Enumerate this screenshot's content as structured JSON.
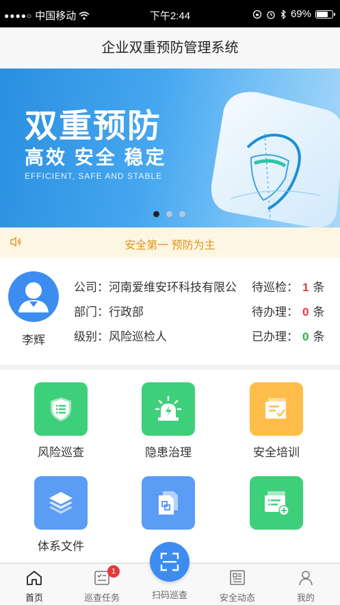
{
  "status_bar": {
    "carrier": "中国移动",
    "time": "下午2:44",
    "battery": "69%"
  },
  "nav": {
    "title": "企业双重预防管理系统"
  },
  "banner": {
    "title": "双重预防",
    "subtitle": "高效 安全 稳定",
    "english": "EFFICIENT, SAFE AND STABLE",
    "page_count": 3,
    "active_page": 1
  },
  "notice": {
    "text": "安全第一 预防为主"
  },
  "profile": {
    "name": "李辉",
    "company_label": "公司：",
    "company": "河南爱维安环科技有限公",
    "department_label": "部门：",
    "department": "行政部",
    "level_label": "级别：",
    "level": "风险巡检人",
    "pending_inspection_label": "待巡检：",
    "pending_inspection": "1",
    "pending_handle_label": "待办理：",
    "pending_handle": "0",
    "done_label": "已办理：",
    "done": "0",
    "unit": "条"
  },
  "menu": {
    "items": [
      {
        "label": "风险巡查",
        "icon": "shield-list-icon",
        "color": "#3ecf7a"
      },
      {
        "label": "隐患治理",
        "icon": "alarm-light-icon",
        "color": "#3ecf7a"
      },
      {
        "label": "安全培训",
        "icon": "training-doc-icon",
        "color": "#ffbd4a"
      },
      {
        "label": "体系文件",
        "icon": "layers-icon",
        "color": "#5b9cf5"
      },
      {
        "label": "",
        "icon": "document-copy-icon",
        "color": "#5b9cf5"
      },
      {
        "label": "",
        "icon": "add-list-icon",
        "color": "#3ecf7a"
      }
    ]
  },
  "tabbar": {
    "tabs": [
      {
        "label": "首页",
        "icon": "home-icon"
      },
      {
        "label": "巡查任务",
        "icon": "task-list-icon",
        "badge": "1"
      },
      {
        "label": "扫码巡查",
        "icon": "scan-icon"
      },
      {
        "label": "安全动态",
        "icon": "news-icon"
      },
      {
        "label": "我的",
        "icon": "user-icon"
      }
    ]
  }
}
